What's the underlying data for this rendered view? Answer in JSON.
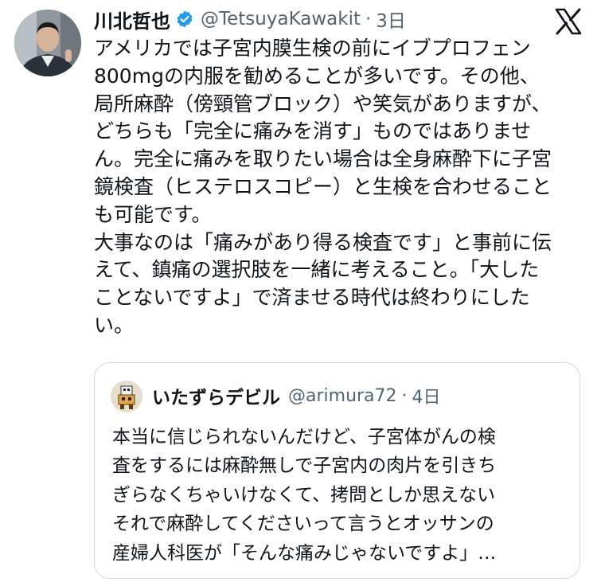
{
  "tweet": {
    "author_name": "川北哲也",
    "handle": "@TetsuyaKawakit",
    "separator": "·",
    "time": "3日",
    "body_lines": [
      "アメリカでは子宮内膜生検の前にイブプロフェン",
      "800mgの内服を勧めることが多いです。その他、",
      "局所麻酔（傍頸管ブロック）や笑気がありますが、",
      "どちらも「完全に痛みを消す」ものではありませ",
      "ん。完全に痛みを取りたい場合は全身麻酔下に子宮",
      "鏡検査（ヒステロスコピー）と生検を合わせること",
      "も可能です。",
      "大事なのは「痛みがあり得る検査です」と事前に伝",
      "えて、鎮痛の選択肢を一緒に考えること。「大した",
      "ことないですよ」で済ませる時代は終わりにした",
      "い。"
    ]
  },
  "quoted": {
    "author_name": "いたずらデビル",
    "handle": "@arimura72",
    "separator": "·",
    "time": "4日",
    "body_lines": [
      "本当に信じられないんだけど、子宮体がんの検",
      "査をするには麻酔無しで子宮内の肉片を引きち",
      "ぎらなくちゃいけなくて、拷問としか思えない",
      "それで麻酔してくださいって言うとオッサンの",
      "産婦人科医が「そんな痛みじゃないですよ」…"
    ]
  },
  "icons": {
    "avatar": "profile-photo",
    "verified": "verified-badge-icon",
    "platform": "x-logo-icon",
    "quoted_avatar": "pixel-art-avatar"
  },
  "colors": {
    "text_primary": "#0f1419",
    "text_secondary": "#536471",
    "verified_blue": "#1d9bf0",
    "border": "#cfd9de"
  }
}
